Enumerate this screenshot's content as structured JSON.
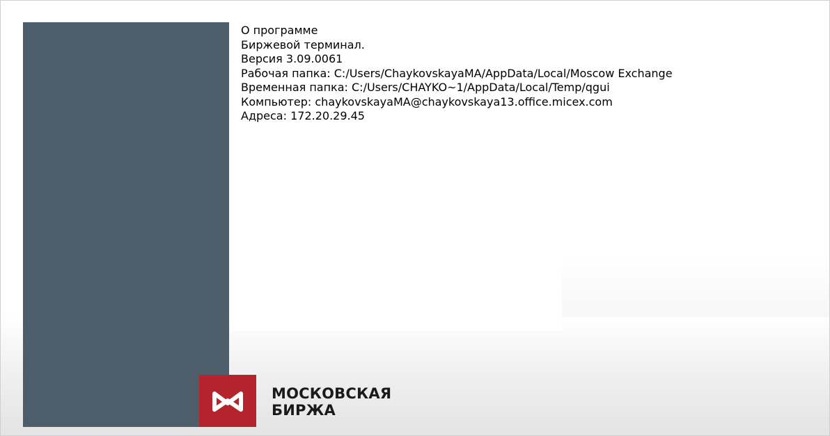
{
  "about": {
    "title": "О программе",
    "product": "Биржевой терминал.",
    "version": "Версия 3.09.0061",
    "work_folder": "Рабочая папка: C:/Users/ChaykovskayaMA/AppData/Local/Moscow Exchange",
    "temp_folder": "Временная папка: C:/Users/CHAYKO~1/AppData/Local/Temp/qgui",
    "computer": "Компьютер: chaykovskayaMA@chaykovskaya13.office.micex.com",
    "addresses": "Адреса: 172.20.29.45"
  },
  "logo": {
    "icon": "moscow-exchange-logo-mark",
    "line1": "МОСКОВСКАЯ",
    "line2": "БИРЖА",
    "brand_color": "#b4242c"
  },
  "colors": {
    "side_panel": "#4d5d69"
  }
}
